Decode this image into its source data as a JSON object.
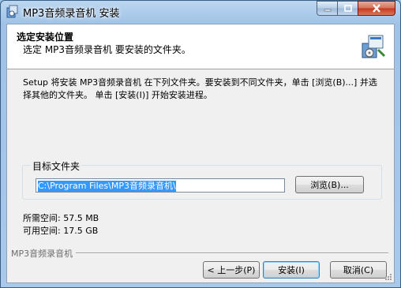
{
  "window": {
    "title": "MP3音频录音机 安装",
    "icon": "installer-icon"
  },
  "caption_buttons": {
    "minimize": "minimize-icon",
    "maximize": "maximize-icon",
    "close": "close-icon"
  },
  "header": {
    "title": "选定安装位置",
    "subtitle": "选定 MP3音频录音机  要安装的文件夹。",
    "icon": "install-package-icon"
  },
  "description": "Setup 将安装 MP3音频录音机  在下列文件夹。要安装到不同文件夹，单击 [浏览(B)...] 并选择其他的文件夹。 单击 [安装(I)] 开始安装进程。",
  "destination": {
    "group_label": "目标文件夹",
    "path": "C:\\Program Files\\MP3音频录音机\\",
    "browse_label": "浏览(B)..."
  },
  "space": {
    "required": "所需空间: 57.5 MB",
    "available": "可用空间: 17.5 GB"
  },
  "branding": "MP3音频录音机",
  "buttons": {
    "back": "< 上一步(P)",
    "install": "安装(I)",
    "cancel": "取消(C)"
  }
}
